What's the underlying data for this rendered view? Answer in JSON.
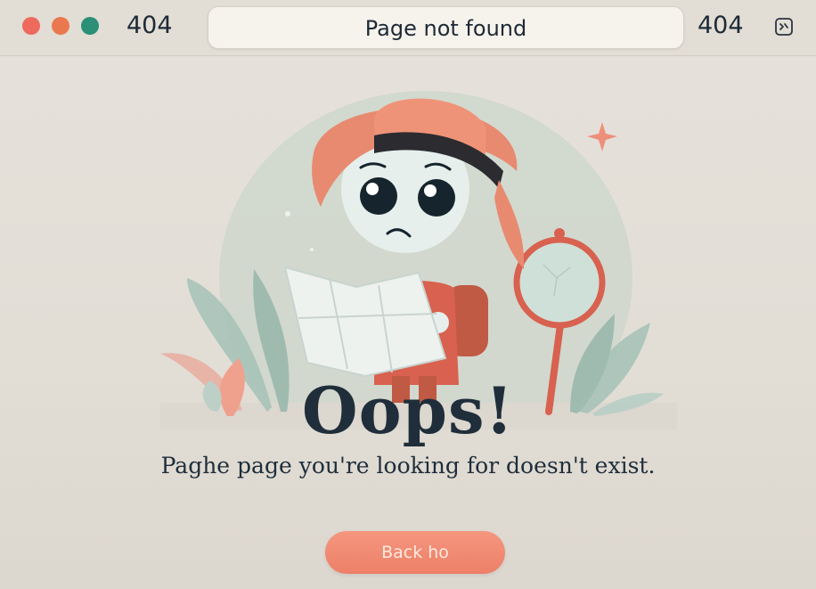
{
  "window": {
    "controls": [
      "close",
      "minimize",
      "maximize"
    ],
    "tab_code": "404",
    "address_text": "Page not found",
    "status_code": "404",
    "tab_icon": "page-icon"
  },
  "content": {
    "illustration": "explorer-character-with-map-and-magnifier",
    "headline": "Oops!",
    "message": "Paghe page you're looking for doesn't exist.",
    "back_button_label": "Back ho"
  },
  "colors": {
    "background": "#e3dfd8",
    "accent": "#ee8068",
    "text": "#1f2e3a",
    "close": "#ee6a5d",
    "minimize": "#e9784f",
    "maximize": "#2c8f77"
  }
}
